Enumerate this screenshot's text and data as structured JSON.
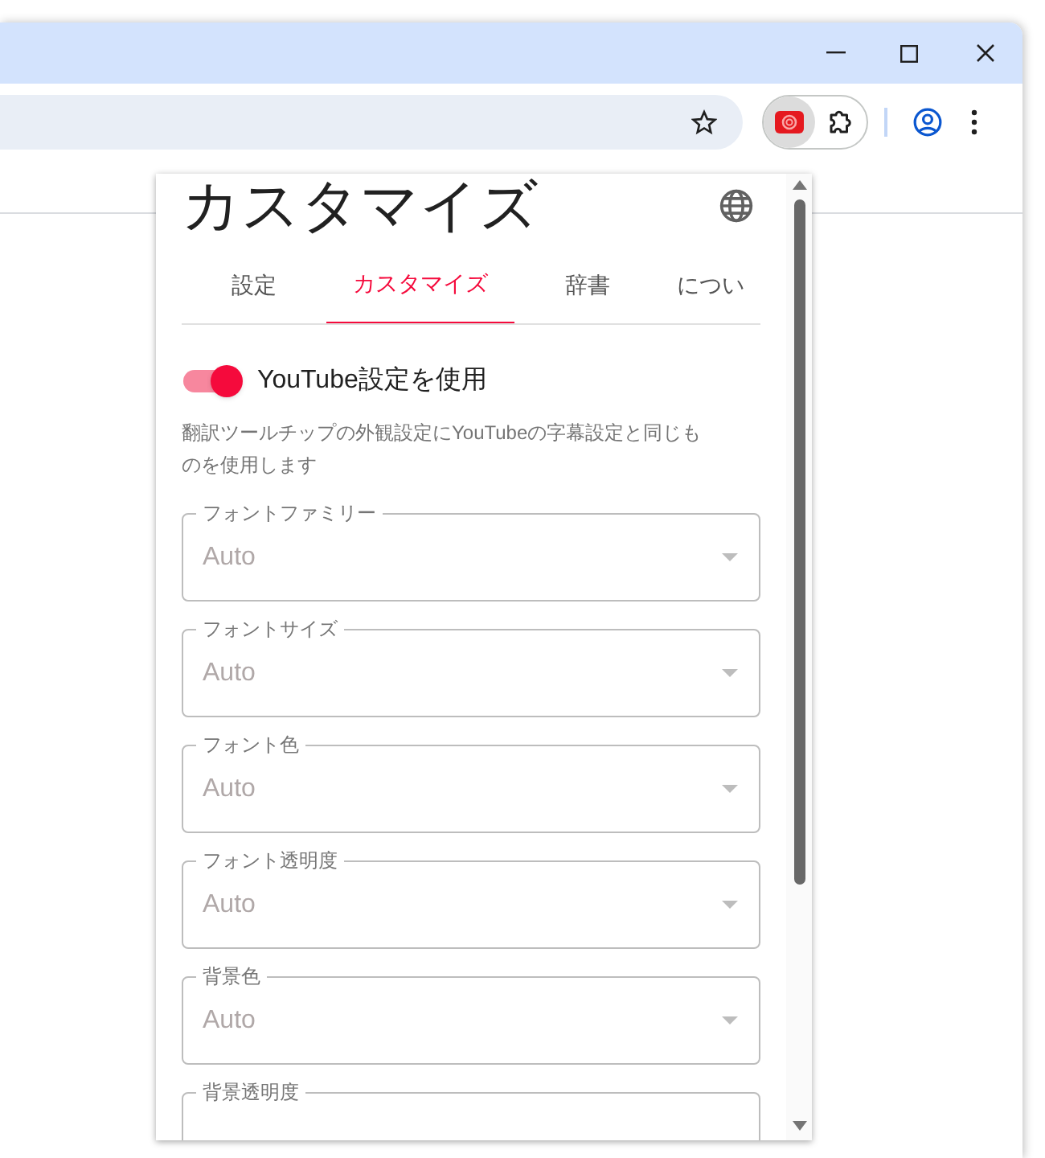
{
  "toolbar": {
    "extension_button": {
      "pressed": true
    }
  },
  "popup": {
    "title": "カスタマイズ",
    "tabs": [
      {
        "label": "設定",
        "selected": false
      },
      {
        "label": "カスタマイズ",
        "selected": true
      },
      {
        "label": "辞書",
        "selected": false
      },
      {
        "label": "につい",
        "selected": false
      }
    ],
    "toggle": {
      "label": "YouTube設定を使用",
      "on": true,
      "description": "翻訳ツールチップの外観設定にYouTubeの字幕設定と同じものを使用します"
    },
    "fields": [
      {
        "label": "フォントファミリー",
        "value": "Auto",
        "disabled": true
      },
      {
        "label": "フォントサイズ",
        "value": "Auto",
        "disabled": true
      },
      {
        "label": "フォント色",
        "value": "Auto",
        "disabled": true
      },
      {
        "label": "フォント透明度",
        "value": "Auto",
        "disabled": true
      },
      {
        "label": "背景色",
        "value": "Auto",
        "disabled": true
      },
      {
        "label": "背景透明度",
        "disabled": true
      }
    ]
  }
}
